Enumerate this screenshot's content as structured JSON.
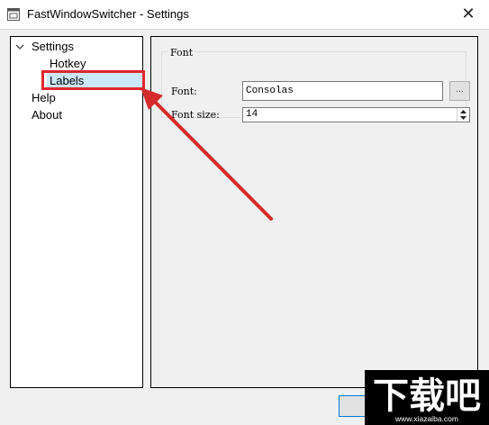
{
  "window": {
    "title": "FastWindowSwitcher - Settings",
    "close_glyph": "✕"
  },
  "icons": {
    "app": "app-window-icon",
    "close": "close-icon",
    "chevron": "chevron-down-icon",
    "browse": "ellipsis-icon",
    "spin_up": "spin-up-icon",
    "spin_down": "spin-down-icon"
  },
  "tree": {
    "items": [
      {
        "label": "Settings",
        "expanded": true
      },
      {
        "label": "Hotkey"
      },
      {
        "label": "Labels",
        "selected": true
      },
      {
        "label": "Help"
      },
      {
        "label": "About"
      }
    ]
  },
  "font_group": {
    "title": "Font",
    "font_label": "Font:",
    "font_value": "Consolas",
    "browse_label": "...",
    "size_label": "Font size:",
    "size_value": "14"
  },
  "watermark": {
    "big": "下载吧",
    "url": "www.xiazaiba.com"
  },
  "colors": {
    "accent": "#0078d7",
    "selection": "#cce8ff",
    "annotation_red": "#e0262d",
    "window_bg": "#f0f0f0"
  }
}
